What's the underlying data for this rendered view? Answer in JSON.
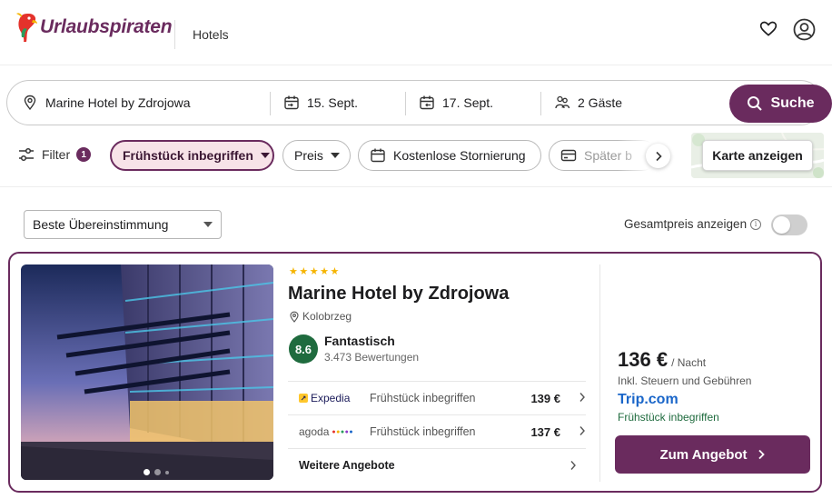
{
  "header": {
    "brand": "Urlaubspiraten",
    "nav": "Hotels"
  },
  "search": {
    "destination": "Marine Hotel by Zdrojowa",
    "checkin": "15. Sept.",
    "checkout": "17. Sept.",
    "guests": "2 Gäste",
    "button": "Suche"
  },
  "filters": {
    "label": "Filter",
    "count": "1",
    "chips": [
      "Frühstück inbegriffen",
      "Preis",
      "Kostenlose Stornierung",
      "Später b"
    ],
    "map_button": "Karte anzeigen"
  },
  "sort": {
    "selected": "Beste Übereinstimmung",
    "total_price_label": "Gesamtpreis anzeigen",
    "total_price_on": false
  },
  "hotel": {
    "stars": 5,
    "name": "Marine Hotel by Zdrojowa",
    "location": "Kolobrzeg",
    "rating": "8.6",
    "rating_word": "Fantastisch",
    "reviews": "3.473 Bewertungen",
    "image_slide": 1,
    "offers": [
      {
        "provider": "Expedia",
        "meal": "Frühstück inbegriffen",
        "price": "139 €"
      },
      {
        "provider": "agoda",
        "meal": "Frühstück inbegriffen",
        "price": "137 €"
      }
    ],
    "more_offers": "Weitere Angebote",
    "best_price": "136 €",
    "per_night": "/ Nacht",
    "tax_note": "Inkl. Steuern und Gebühren",
    "best_provider": "Trip.com",
    "best_meal": "Frühstück inbegriffen",
    "cta": "Zum Angebot"
  },
  "colors": {
    "brand": "#6a2b5e",
    "rating": "#1f6b3e",
    "star": "#f5b400",
    "provider_link": "#1a66c9"
  }
}
